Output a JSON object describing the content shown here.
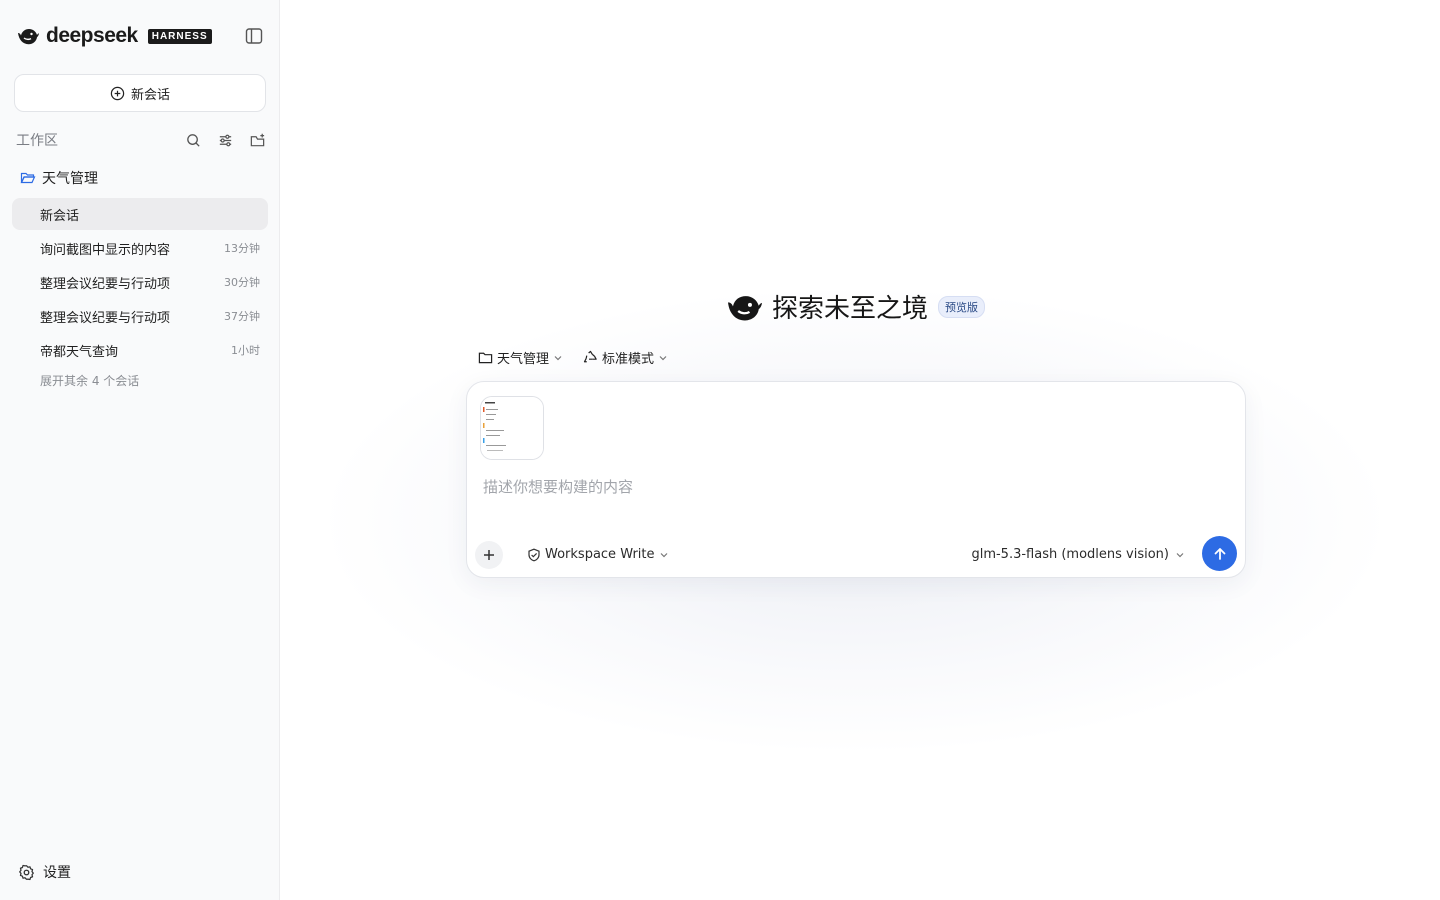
{
  "brand": {
    "name": "deepseek",
    "badge": "HARNESS",
    "accent": "#1b1b1b"
  },
  "sidebar": {
    "new_chat_label": "新会话",
    "workspace_title": "工作区",
    "folder_name": "天气管理",
    "sessions": [
      {
        "title": "新会话",
        "time": "",
        "active": true
      },
      {
        "title": "询问截图中显示的内容",
        "time": "13分钟",
        "active": false
      },
      {
        "title": "整理会议纪要与行动项",
        "time": "30分钟",
        "active": false
      },
      {
        "title": "整理会议纪要与行动项",
        "time": "37分钟",
        "active": false
      },
      {
        "title": "帝都天气查询",
        "time": "1小时",
        "active": false
      }
    ],
    "expand_more": "展开其余 4 个会话",
    "settings_label": "设置"
  },
  "main": {
    "hero_title": "探索未至之境",
    "hero_badge": "预览版",
    "project_selector": "天气管理",
    "mode_selector": "标准模式",
    "composer": {
      "placeholder": "描述你想要构建的内容",
      "permission": "Workspace Write",
      "model": "glm-5.3-flash (modlens vision)"
    },
    "send_color": "#2d6be4"
  }
}
